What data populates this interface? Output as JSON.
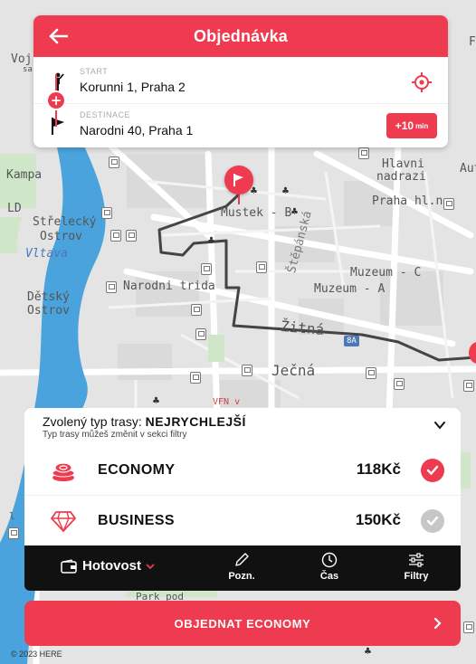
{
  "colors": {
    "accent": "#ef3b4f",
    "toolbar": "#111111",
    "river": "#4aa3dc",
    "park": "#cfe6c8"
  },
  "map": {
    "labels": {
      "voj": "Voj",
      "sa": "sa",
      "kampa": "Kampa",
      "ld": "LD",
      "strelecky": "Střelecký",
      "ostrov1": "Ostrov",
      "vltava": "Vltava",
      "detsky": "Dětský",
      "ostrov2": "Ostrov",
      "mustek": "Mustek - B",
      "hlavni": "Hlavni",
      "nadrazi": "nadrazi",
      "au": "Aut",
      "praha_hln": "Praha hl.n.",
      "stepanska": "Štěpánská",
      "muzeum_c": "Muzeum - C",
      "muzeum_a": "Muzeum - A",
      "narodni_trida": "Narodni trida",
      "zitna": "Žitná",
      "jecna": "Ječná",
      "vfn": "VFN v",
      "park_pod": "Park pod",
      "f": "F",
      "route_8a": "8A",
      "lbr": "l"
    },
    "copyright": "© 2023 HERE"
  },
  "header": {
    "title": "Objednávka",
    "start_label": "START",
    "start_value": "Korunni 1, Praha 2",
    "dest_label": "DESTINACE",
    "dest_value": "Narodni 40, Praha 1",
    "time_badge": "+10",
    "time_unit": "min"
  },
  "sheet": {
    "route_type_prefix": "Zvolený typ trasy:",
    "route_type_value": "NEJRYCHLEJŠÍ",
    "route_hint": "Typ trasy můžeš změnit v sekci filtry",
    "options": [
      {
        "name": "ECONOMY",
        "price": "118Kč",
        "selected": true,
        "icon": "coins-icon"
      },
      {
        "name": "BUSINESS",
        "price": "150Kč",
        "selected": false,
        "icon": "diamond-icon"
      }
    ]
  },
  "toolbar": {
    "payment": "Hotovost",
    "note": "Pozn.",
    "time": "Čas",
    "filters": "Filtry"
  },
  "order_button": "OBJEDNAT ECONOMY"
}
